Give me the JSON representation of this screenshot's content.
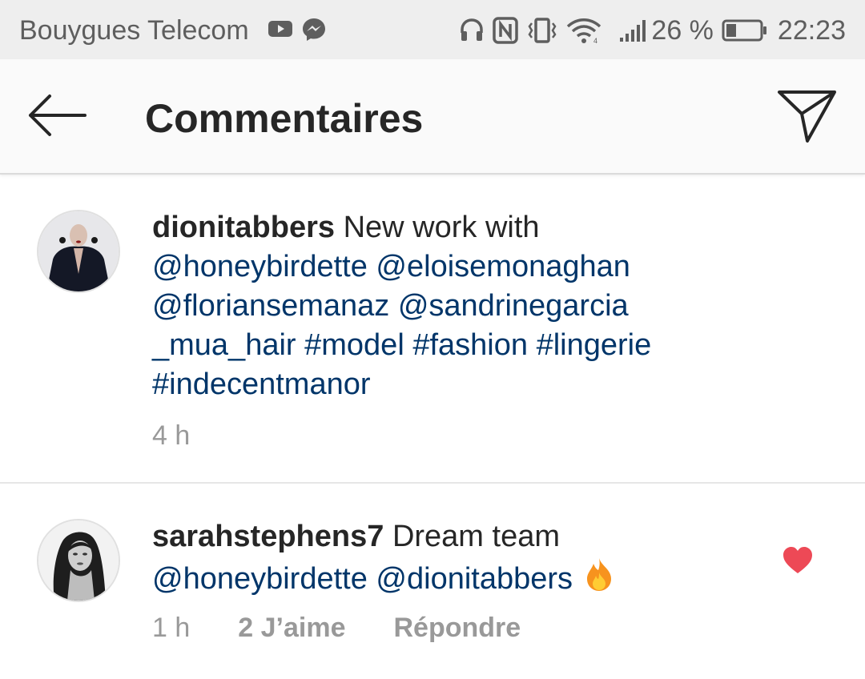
{
  "status_bar": {
    "carrier": "Bouygues Telecom",
    "battery": "26 %",
    "time": "22:23"
  },
  "header": {
    "title": "Commentaires"
  },
  "comments": [
    {
      "username": "dionitabbers",
      "text": "New work with",
      "tags": [
        "@honeybirdette",
        "@eloisemonaghan",
        "@floriansemanaz",
        "@sandrinegarcia",
        "_mua_hair",
        "#model",
        "#fashion",
        "#lingerie",
        "#indecentmanor"
      ],
      "time": "4 h"
    },
    {
      "username": "sarahstephens7",
      "text": "Dream team",
      "tags": [
        "@honeybirdette",
        "@dionitabbers"
      ],
      "time": "1 h",
      "likes": "2 J’aime",
      "reply": "Répondre",
      "liked": true
    }
  ],
  "colors": {
    "link": "#003569",
    "heart": "#ed4956",
    "meta": "#999999"
  }
}
